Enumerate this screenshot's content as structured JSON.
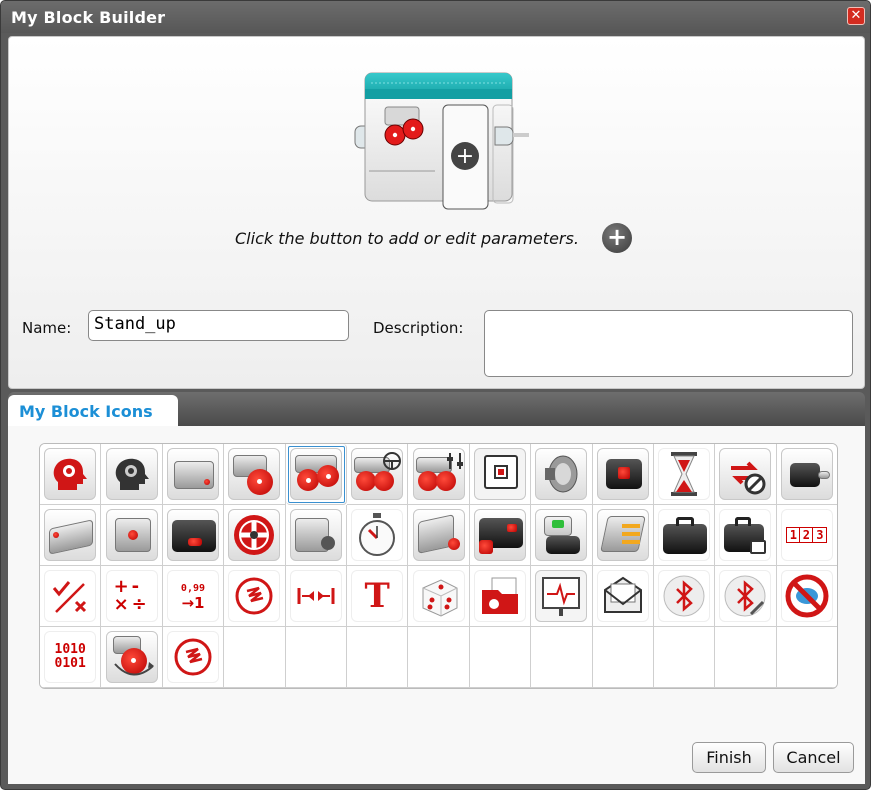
{
  "window": {
    "title": "My Block Builder",
    "close_icon": "close-icon"
  },
  "preview": {
    "hint": "Click the button to add or edit parameters.",
    "add_icon": "plus-circle-icon",
    "colors": {
      "header": "#1fb5b8",
      "motor_red": "#e31b1b",
      "plus": "#444444"
    }
  },
  "form": {
    "name_label": "Name:",
    "name_value": "Stand_up",
    "description_label": "Description:",
    "description_value": ""
  },
  "tabs": [
    {
      "label": "My Block Icons",
      "active": true
    }
  ],
  "icons": [
    {
      "name": "brain-red-icon"
    },
    {
      "name": "brain-gray-icon"
    },
    {
      "name": "brick-icon"
    },
    {
      "name": "large-motor-icon"
    },
    {
      "name": "move-tank-icon",
      "selected": true
    },
    {
      "name": "move-steering-icon"
    },
    {
      "name": "tank-motors-icon"
    },
    {
      "name": "display-icon"
    },
    {
      "name": "sound-icon"
    },
    {
      "name": "brick-buttons-icon"
    },
    {
      "name": "timer-hourglass-icon"
    },
    {
      "name": "loop-interrupt-icon"
    },
    {
      "name": "brick-status-light-icon"
    },
    {
      "name": "ultrasonic-sensor-icon"
    },
    {
      "name": "color-sensor-icon"
    },
    {
      "name": "infrared-sensor-icon"
    },
    {
      "name": "rotation-sensor-icon"
    },
    {
      "name": "touch-sensor-icon"
    },
    {
      "name": "stopwatch-icon"
    },
    {
      "name": "gyro-sensor-icon"
    },
    {
      "name": "beacon-icon"
    },
    {
      "name": "temperature-sensor-icon"
    },
    {
      "name": "energy-meter-icon"
    },
    {
      "name": "toolbox-icon"
    },
    {
      "name": "toolbox-lock-icon"
    },
    {
      "name": "array-icon"
    },
    {
      "name": "logic-icon"
    },
    {
      "name": "math-icon"
    },
    {
      "name": "round-icon"
    },
    {
      "name": "compare-icon"
    },
    {
      "name": "range-icon"
    },
    {
      "name": "text-icon"
    },
    {
      "name": "random-dice-icon"
    },
    {
      "name": "file-access-icon"
    },
    {
      "name": "datalog-icon"
    },
    {
      "name": "messaging-icon"
    },
    {
      "name": "bluetooth-icon"
    },
    {
      "name": "bluetooth-settings-icon"
    },
    {
      "name": "no-messages-icon"
    },
    {
      "name": "binary-icon"
    },
    {
      "name": "motor-rotate-icon"
    },
    {
      "name": "raw-sensor-icon"
    }
  ],
  "icon_text": {
    "math": {
      "plus": "+",
      "minus": "-",
      "times": "×",
      "divide": "÷"
    },
    "round": {
      "top": "0,99",
      "bottom": "→1"
    },
    "text_glyph": "T",
    "binary_top": "1010",
    "binary_bottom": "0101",
    "array_cells": [
      "1",
      "2",
      "3"
    ]
  },
  "actions": {
    "finish_label": "Finish",
    "cancel_label": "Cancel"
  }
}
